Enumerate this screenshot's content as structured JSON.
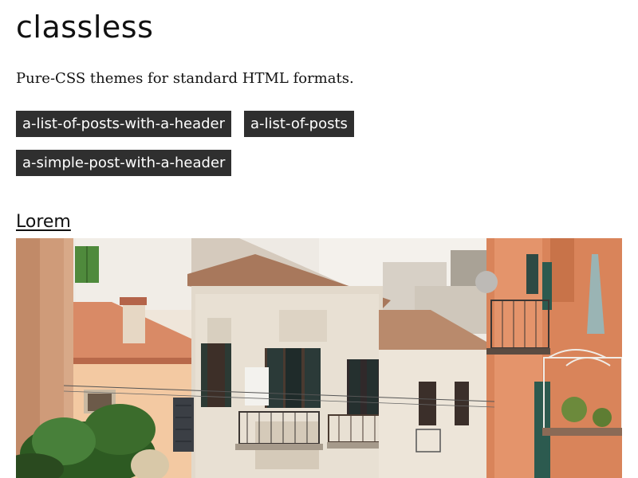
{
  "site": {
    "title": "classless",
    "subtitle": "Pure-CSS themes for standard HTML formats."
  },
  "tags": [
    {
      "label": "a-list-of-posts-with-a-header"
    },
    {
      "label": "a-list-of-posts"
    },
    {
      "label": "a-simple-post-with-a-header"
    }
  ],
  "post": {
    "title": "Lorem"
  },
  "colors": {
    "tag_background": "#2f2f2f",
    "tag_text": "#ffffff",
    "text": "#111111",
    "background": "#ffffff"
  }
}
